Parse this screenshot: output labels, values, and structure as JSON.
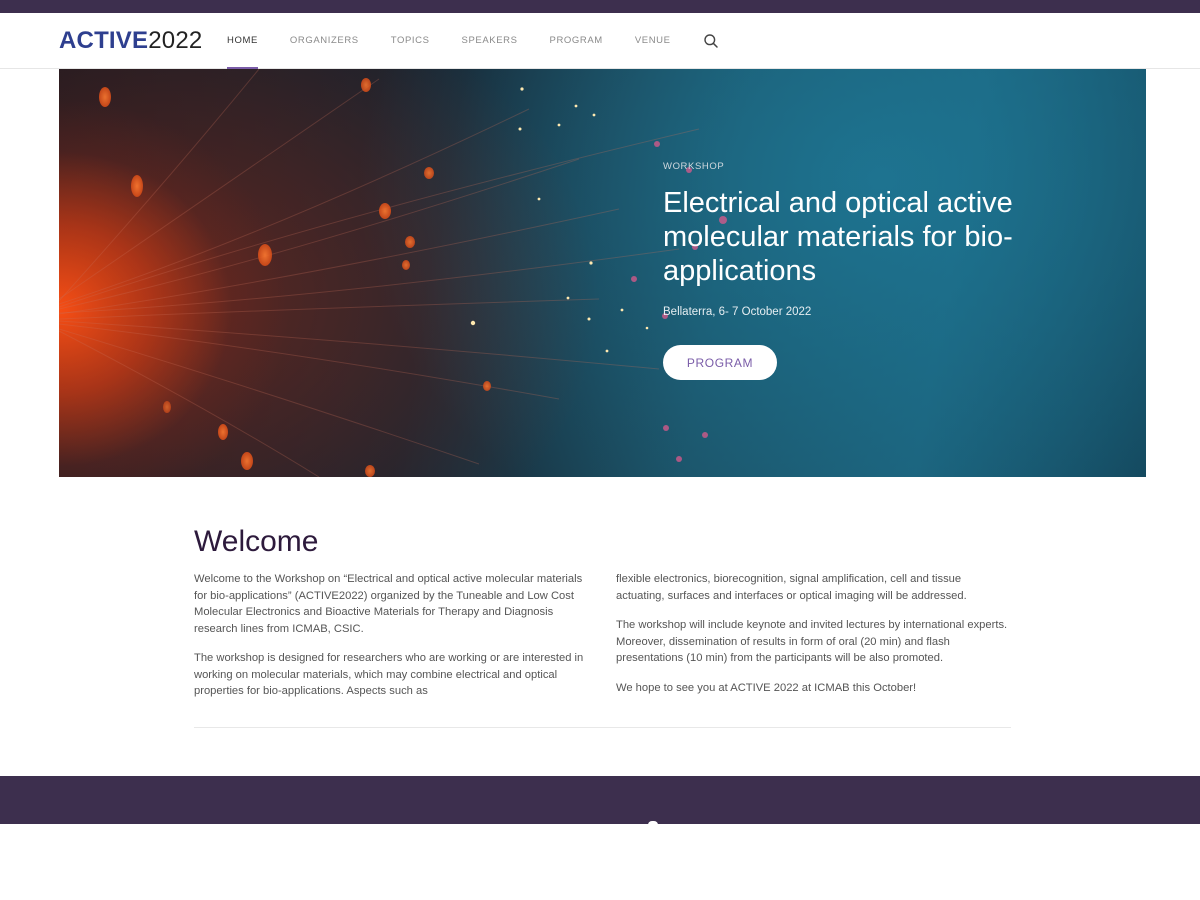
{
  "brand": {
    "logo_bold": "ACTIVE",
    "logo_thin": "2022"
  },
  "nav": {
    "items": [
      {
        "label": "HOME",
        "active": true
      },
      {
        "label": "ORGANIZERS",
        "active": false
      },
      {
        "label": "TOPICS",
        "active": false
      },
      {
        "label": "SPEAKERS",
        "active": false
      },
      {
        "label": "PROGRAM",
        "active": false
      },
      {
        "label": "VENUE",
        "active": false
      }
    ],
    "search_icon": "search-icon"
  },
  "hero": {
    "eyebrow": "WORKSHOP",
    "title": "Electrical and optical active molecular materials for bio-applications",
    "subtitle": "Bellaterra, 6- 7 October 2022",
    "button_label": "PROGRAM"
  },
  "welcome": {
    "heading": "Welcome",
    "col1": [
      "Welcome to the Workshop on “Electrical and optical active molecular materials for bio-applications” (ACTIVE2022) organized by the Tuneable and Low Cost Molecular Electronics and Bioactive Materials for Therapy and Diagnosis research lines from ICMAB, CSIC.",
      "The workshop is designed for researchers who are working or are interested in working on molecular materials, which may combine electrical and optical properties for bio-applications. Aspects such as"
    ],
    "col2": [
      "flexible electronics, biorecognition, signal amplification, cell and tissue actuating, surfaces and interfaces or optical imaging will be addressed.",
      "The workshop will include keynote and invited lectures by international experts. Moreover, dissemination of results in form of oral (20 min) and flash presentations (10 min) from the participants will be also promoted.",
      "We hope to see you at ACTIVE 2022 at ICMAB this October!"
    ]
  },
  "colors": {
    "brand_dark": "#3d2f4e",
    "logo_blue": "#2e3f8f",
    "accent_purple": "#7a5ca8",
    "heading": "#2d1a3c"
  }
}
